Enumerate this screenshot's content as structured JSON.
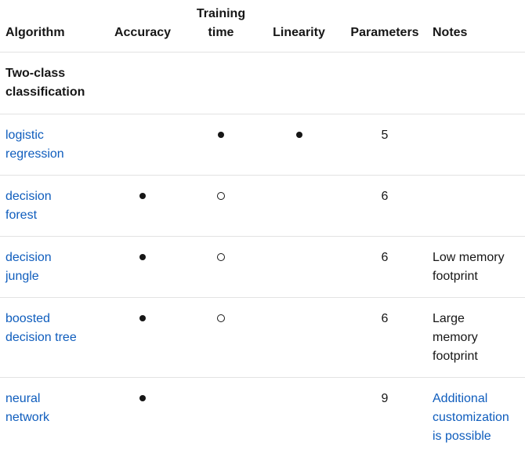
{
  "headers": {
    "algorithm": "Algorithm",
    "accuracy": "Accuracy",
    "training_time": "Training time",
    "linearity": "Linearity",
    "parameters": "Parameters",
    "notes": "Notes"
  },
  "groups": [
    {
      "label": "Two-class classification"
    }
  ],
  "rows": [
    {
      "algorithm": "logistic regression",
      "accuracy": "",
      "training_time": "filled-dot",
      "linearity": "filled-dot",
      "parameters": "5",
      "notes": ""
    },
    {
      "algorithm": "decision forest",
      "accuracy": "filled-dot",
      "training_time": "open-dot",
      "linearity": "",
      "parameters": "6",
      "notes": ""
    },
    {
      "algorithm": "decision jungle",
      "accuracy": "filled-dot",
      "training_time": "open-dot",
      "linearity": "",
      "parameters": "6",
      "notes": "Low memory footprint"
    },
    {
      "algorithm": "boosted decision tree",
      "accuracy": "filled-dot",
      "training_time": "open-dot",
      "linearity": "",
      "parameters": "6",
      "notes": "Large memory footprint"
    },
    {
      "algorithm": "neural network",
      "accuracy": "filled-dot",
      "training_time": "",
      "linearity": "",
      "parameters": "9",
      "notes": "Additional customization is possible",
      "notes_is_link": true
    }
  ]
}
